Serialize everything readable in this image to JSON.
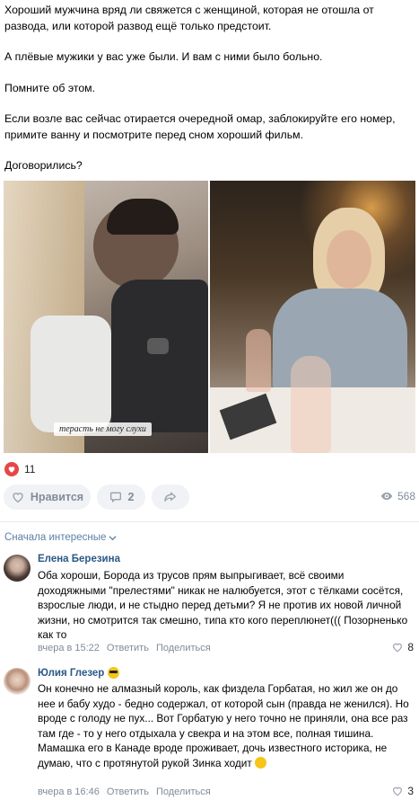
{
  "post": {
    "paragraphs": [
      "Хороший мужчина вряд ли свяжется с женщиной, которая не отошла от развода, или которой развод ещё только предстоит.",
      "А плёвые мужики у вас уже были. И вам с ними было больно.",
      "Помните об этом.",
      "Если возле вас сейчас отирается очередной омар, заблокируйте его номер, примите ванну и посмотрите перед сном хороший фильм.",
      "Договорились?"
    ],
    "photo_caption": "терасть не могу слухи",
    "reactions_count": "11"
  },
  "actions": {
    "like_label": "Нравится",
    "comments_count": "2",
    "views": "568"
  },
  "sort_label": "Сначала интересные",
  "comments": [
    {
      "author": "Елена Березина",
      "text": "Оба хороши, Борода из трусов прям выпрыгивает, всё своими доходяжными \"прелестями\" никак не налюбуется, этот с тёлками сосётся, взрослые люди, и не стыдно перед детьми? Я не против их новой личной жизни, но смотрится так смешно, типа кто кого переплюнет((( Позорненько как то",
      "time": "вчера в 15:22",
      "reply": "Ответить",
      "share": "Поделиться",
      "likes": "8"
    },
    {
      "author": "Юлия Глезер",
      "text": "Он конечно не алмазный король, как физдела Горбатая, но жил же он до нее и бабу худо - бедно содержал, от которой сын (правда не женился). Но вроде с голоду не пух... Вот Горбатую у него точно не приняли, она все раз там где - то у него отдыхала у свекра и на этом все, полная тишина. Мамашка его в Канаде вроде проживает, дочь известного историка, не думаю, что с протянутой рукой Зинка ходит",
      "time": "вчера в 16:46",
      "reply": "Ответить",
      "share": "Поделиться",
      "likes": "3"
    }
  ],
  "colors": {
    "link": "#2a5885",
    "meta": "#818c99",
    "pill_bg": "#f0f2f5",
    "heart": "#e64646"
  }
}
